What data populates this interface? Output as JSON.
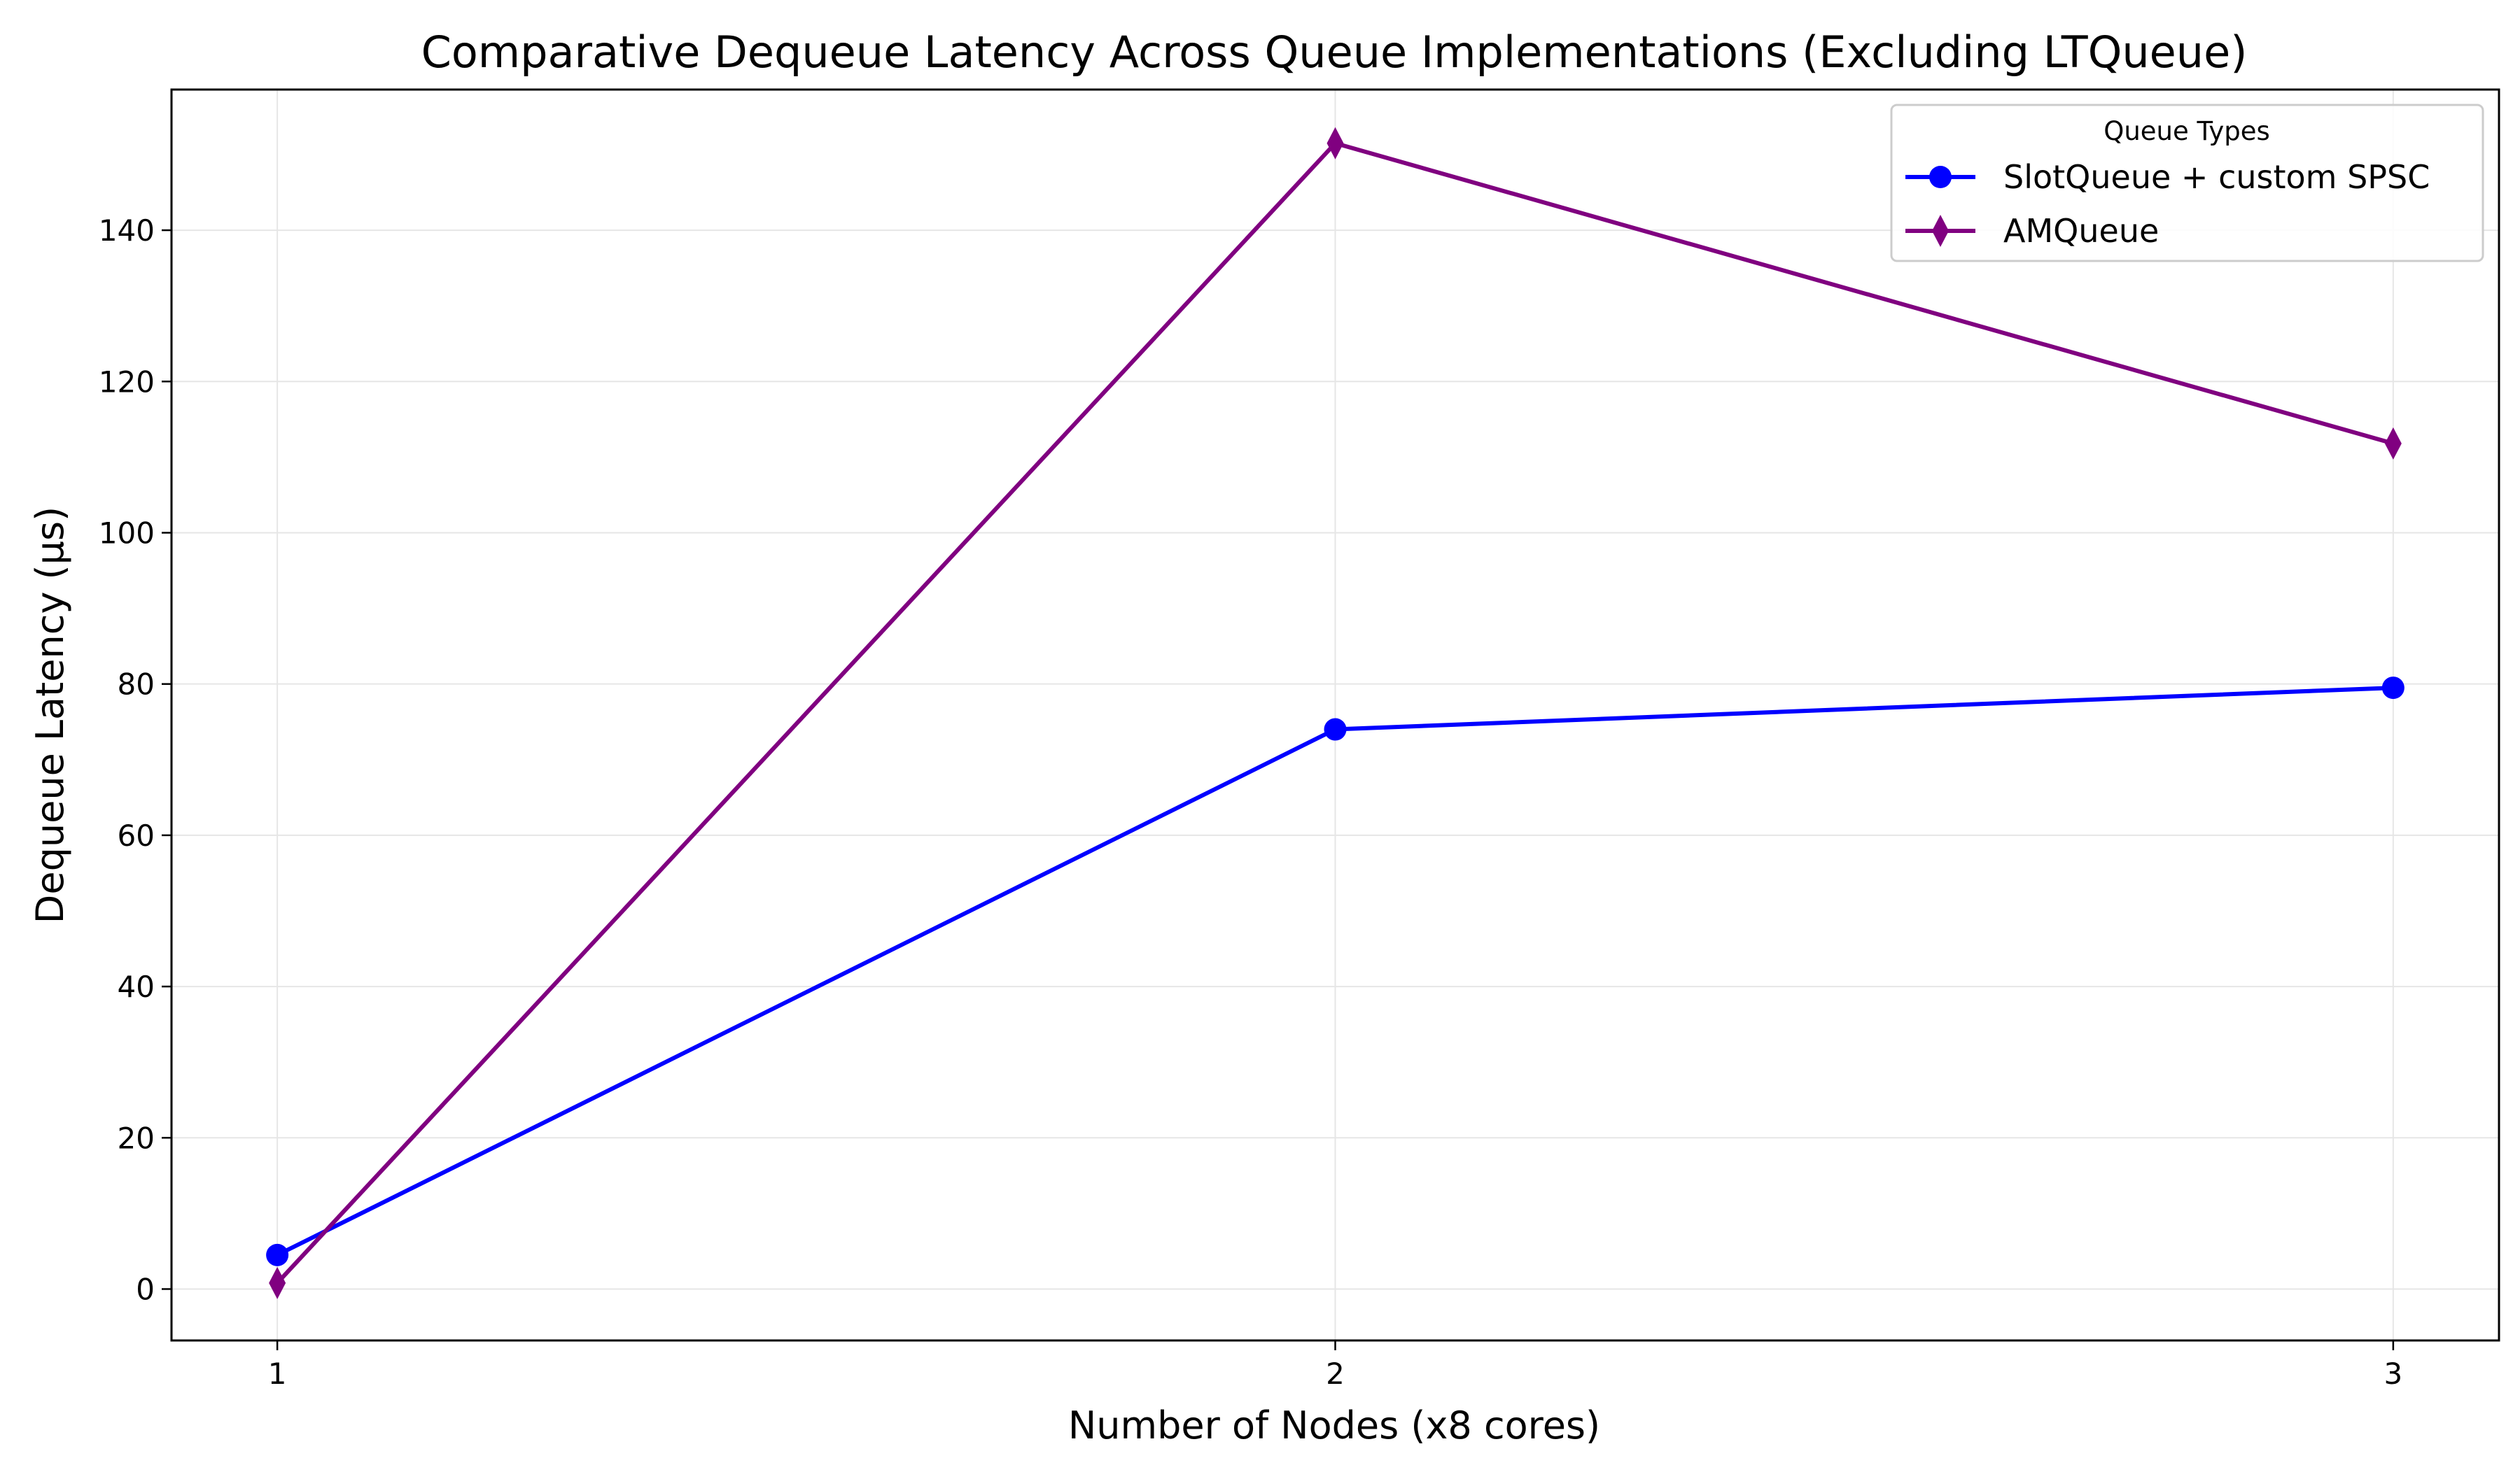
{
  "chart_data": {
    "type": "line",
    "title": "Comparative Dequeue Latency Across Queue Implementations (Excluding LTQueue)",
    "xlabel": "Number of Nodes (x8 cores)",
    "ylabel": "Dequeue Latency (µs)",
    "x": [
      1,
      2,
      3
    ],
    "x_tick_labels": [
      "1",
      "2",
      "3"
    ],
    "xlim": [
      0.9,
      3.1
    ],
    "ylim": [
      -6.8,
      158.6
    ],
    "y_ticks": [
      0,
      20,
      40,
      60,
      80,
      100,
      120,
      140
    ],
    "y_tick_labels": [
      "0",
      "20",
      "40",
      "60",
      "80",
      "100",
      "120",
      "140"
    ],
    "grid": true,
    "legend": {
      "title": "Queue Types",
      "placement": "top-right"
    },
    "series": [
      {
        "name": "SlotQueue + custom SPSC",
        "values": [
          4.5,
          74.0,
          79.5
        ],
        "color": "#0000ff",
        "marker": "circle"
      },
      {
        "name": "AMQueue",
        "values": [
          0.8,
          151.5,
          111.8
        ],
        "color": "#800080",
        "marker": "thin-diamond"
      }
    ]
  }
}
